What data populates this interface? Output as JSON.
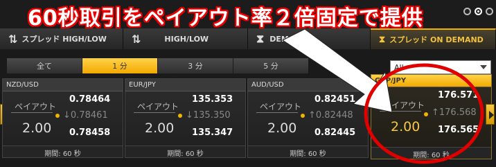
{
  "banner": {
    "text": "60秒取引をペイアウト率２倍固定で提供"
  },
  "mode_tabs": [
    {
      "label": "スプレッド HIGH/LOW",
      "icon": "updown-arrows-icon"
    },
    {
      "label": "HIGH/LOW",
      "icon": "updown-arrows-icon"
    },
    {
      "label": "DEMAND",
      "icon": "hourglass-icon"
    },
    {
      "label": "スプレッド ON DEMAND",
      "icon": "hourglass-icon"
    }
  ],
  "time_tabs": [
    "全て",
    "1 分",
    "3 分",
    "5 分"
  ],
  "filter": {
    "selected": "All"
  },
  "cards": [
    {
      "pair": "NZD/USD",
      "payout_label": "ペイアウト",
      "payout": "2.00",
      "price_top": "0.78464",
      "price_mid": "↓0.78461",
      "price_bot": "0.78458",
      "period": "期間: 60 秒"
    },
    {
      "pair": "EUR/JPY",
      "payout_label": "ペイアウト",
      "payout": "2.00",
      "price_top": "135.353",
      "price_mid": "↓135.350",
      "price_bot": "135.347",
      "period": "期間: 60 秒"
    },
    {
      "pair": "AUD/USD",
      "payout_label": "ペイアウト",
      "payout": "2.00",
      "price_top": "0.82451",
      "price_mid": "↑0.82448",
      "price_bot": "0.82445",
      "period": "期間: 60 秒"
    },
    {
      "pair": "GBP/JPY",
      "payout_label": "ペイアウト",
      "payout": "2.00",
      "price_top": "176.571",
      "price_mid": "↑176.568",
      "price_bot": "176.565",
      "period": "期間: 60 秒"
    }
  ],
  "colors": {
    "accent": "#f2a900",
    "annotation": "#e00000"
  }
}
